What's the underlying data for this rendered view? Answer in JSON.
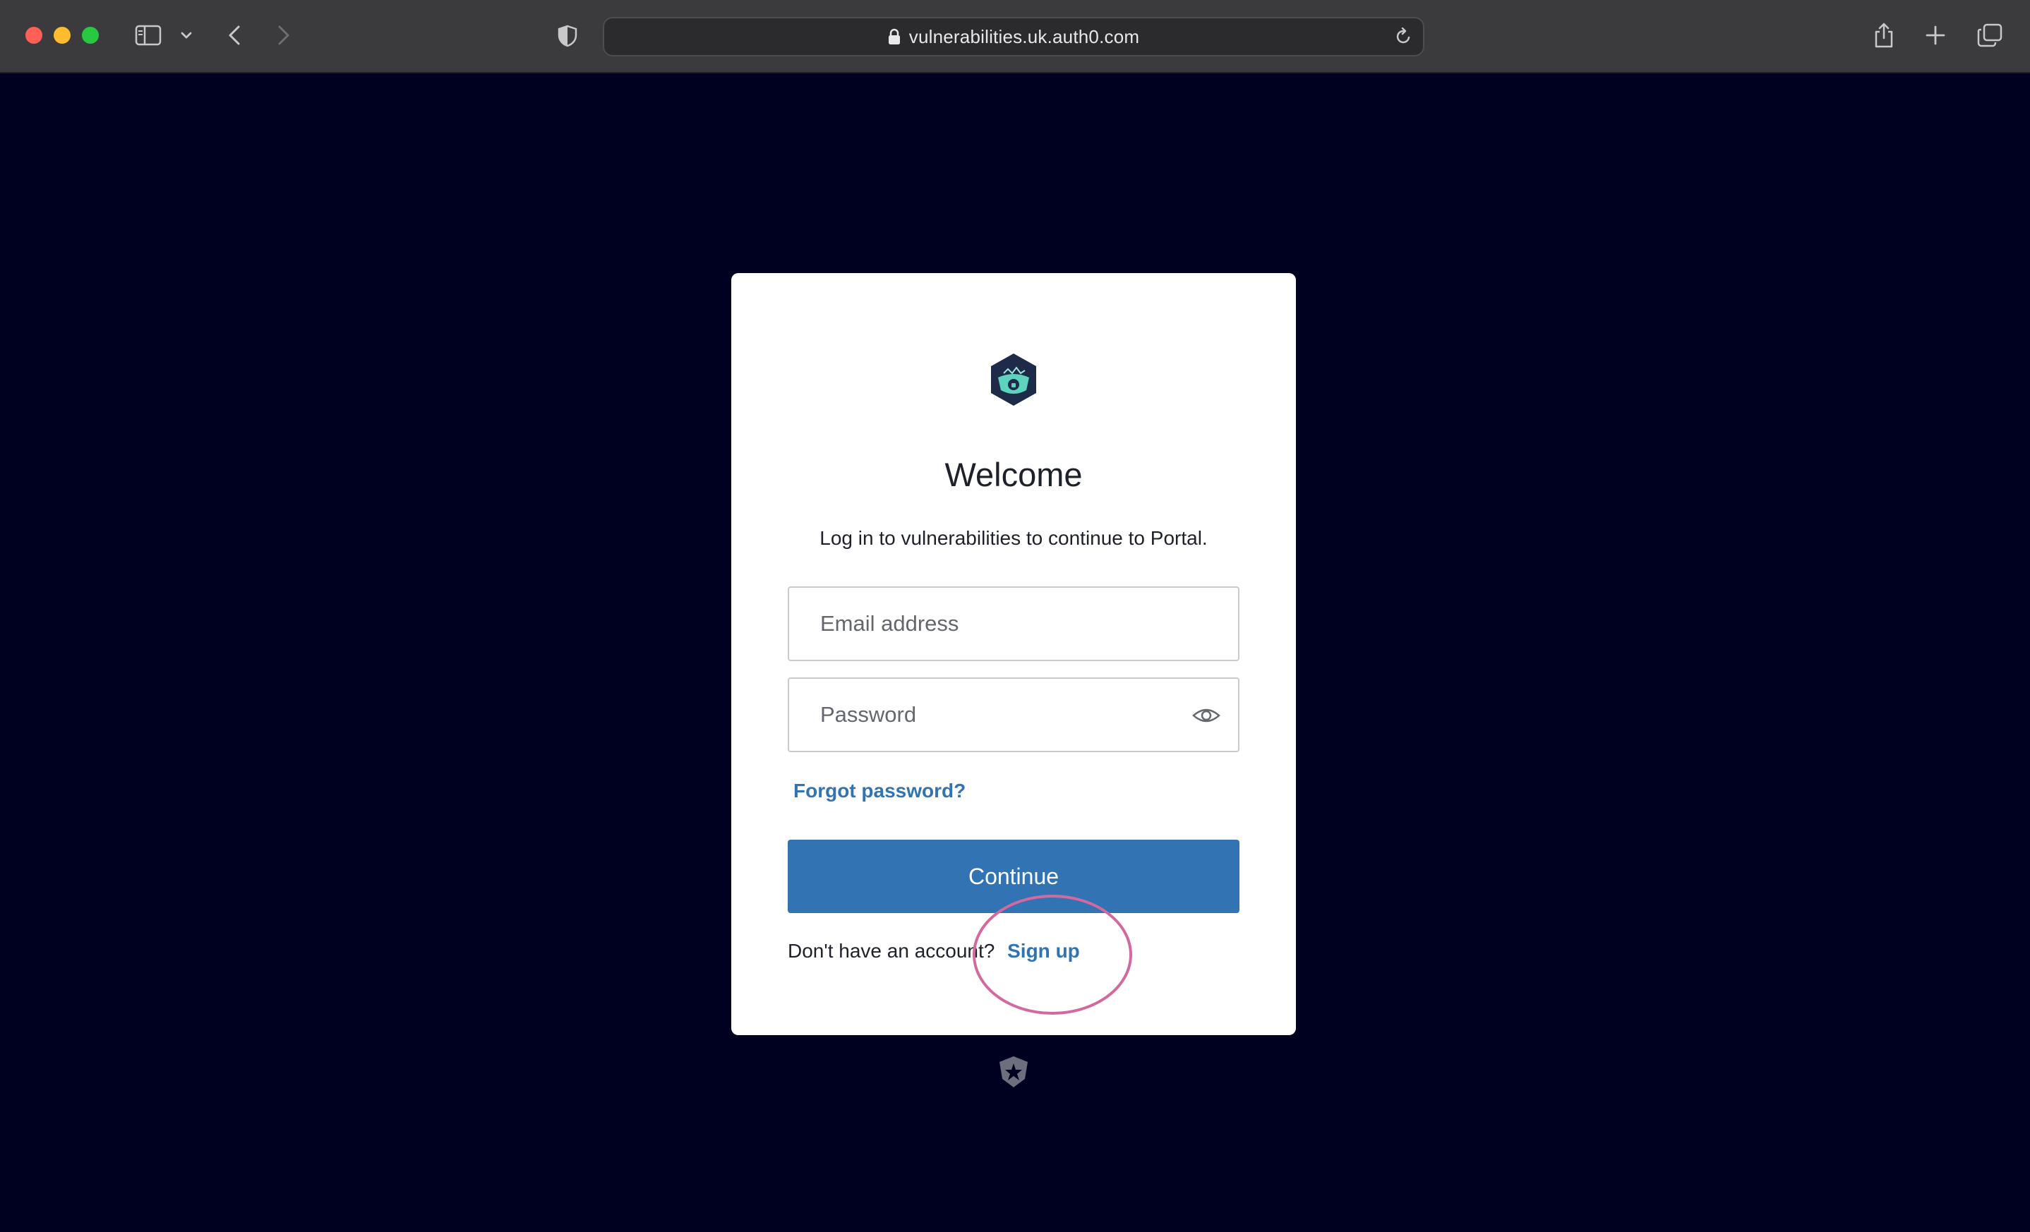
{
  "browser": {
    "url": "vulnerabilities.uk.auth0.com",
    "icons": {
      "close": "close-icon",
      "minimize": "minimize-icon",
      "maximize": "maximize-icon",
      "sidebar": "sidebar-icon",
      "chevron": "chevron-down-icon",
      "back": "back-icon",
      "forward": "forward-icon",
      "privacy": "shield-icon",
      "lock": "lock-icon",
      "reload": "reload-icon",
      "share": "share-icon",
      "new_tab": "plus-icon",
      "tabs": "tab-overview-icon"
    }
  },
  "login": {
    "title": "Welcome",
    "subtitle": "Log in to vulnerabilities to continue to Portal.",
    "email_placeholder": "Email address",
    "password_placeholder": "Password",
    "forgot_label": "Forgot password?",
    "continue_label": "Continue",
    "signup_prompt": "Don't have an account?",
    "signup_label": "Sign up"
  },
  "colors": {
    "page_background": "#000120",
    "primary": "#3173b3",
    "annotation": "#d36a9f"
  }
}
